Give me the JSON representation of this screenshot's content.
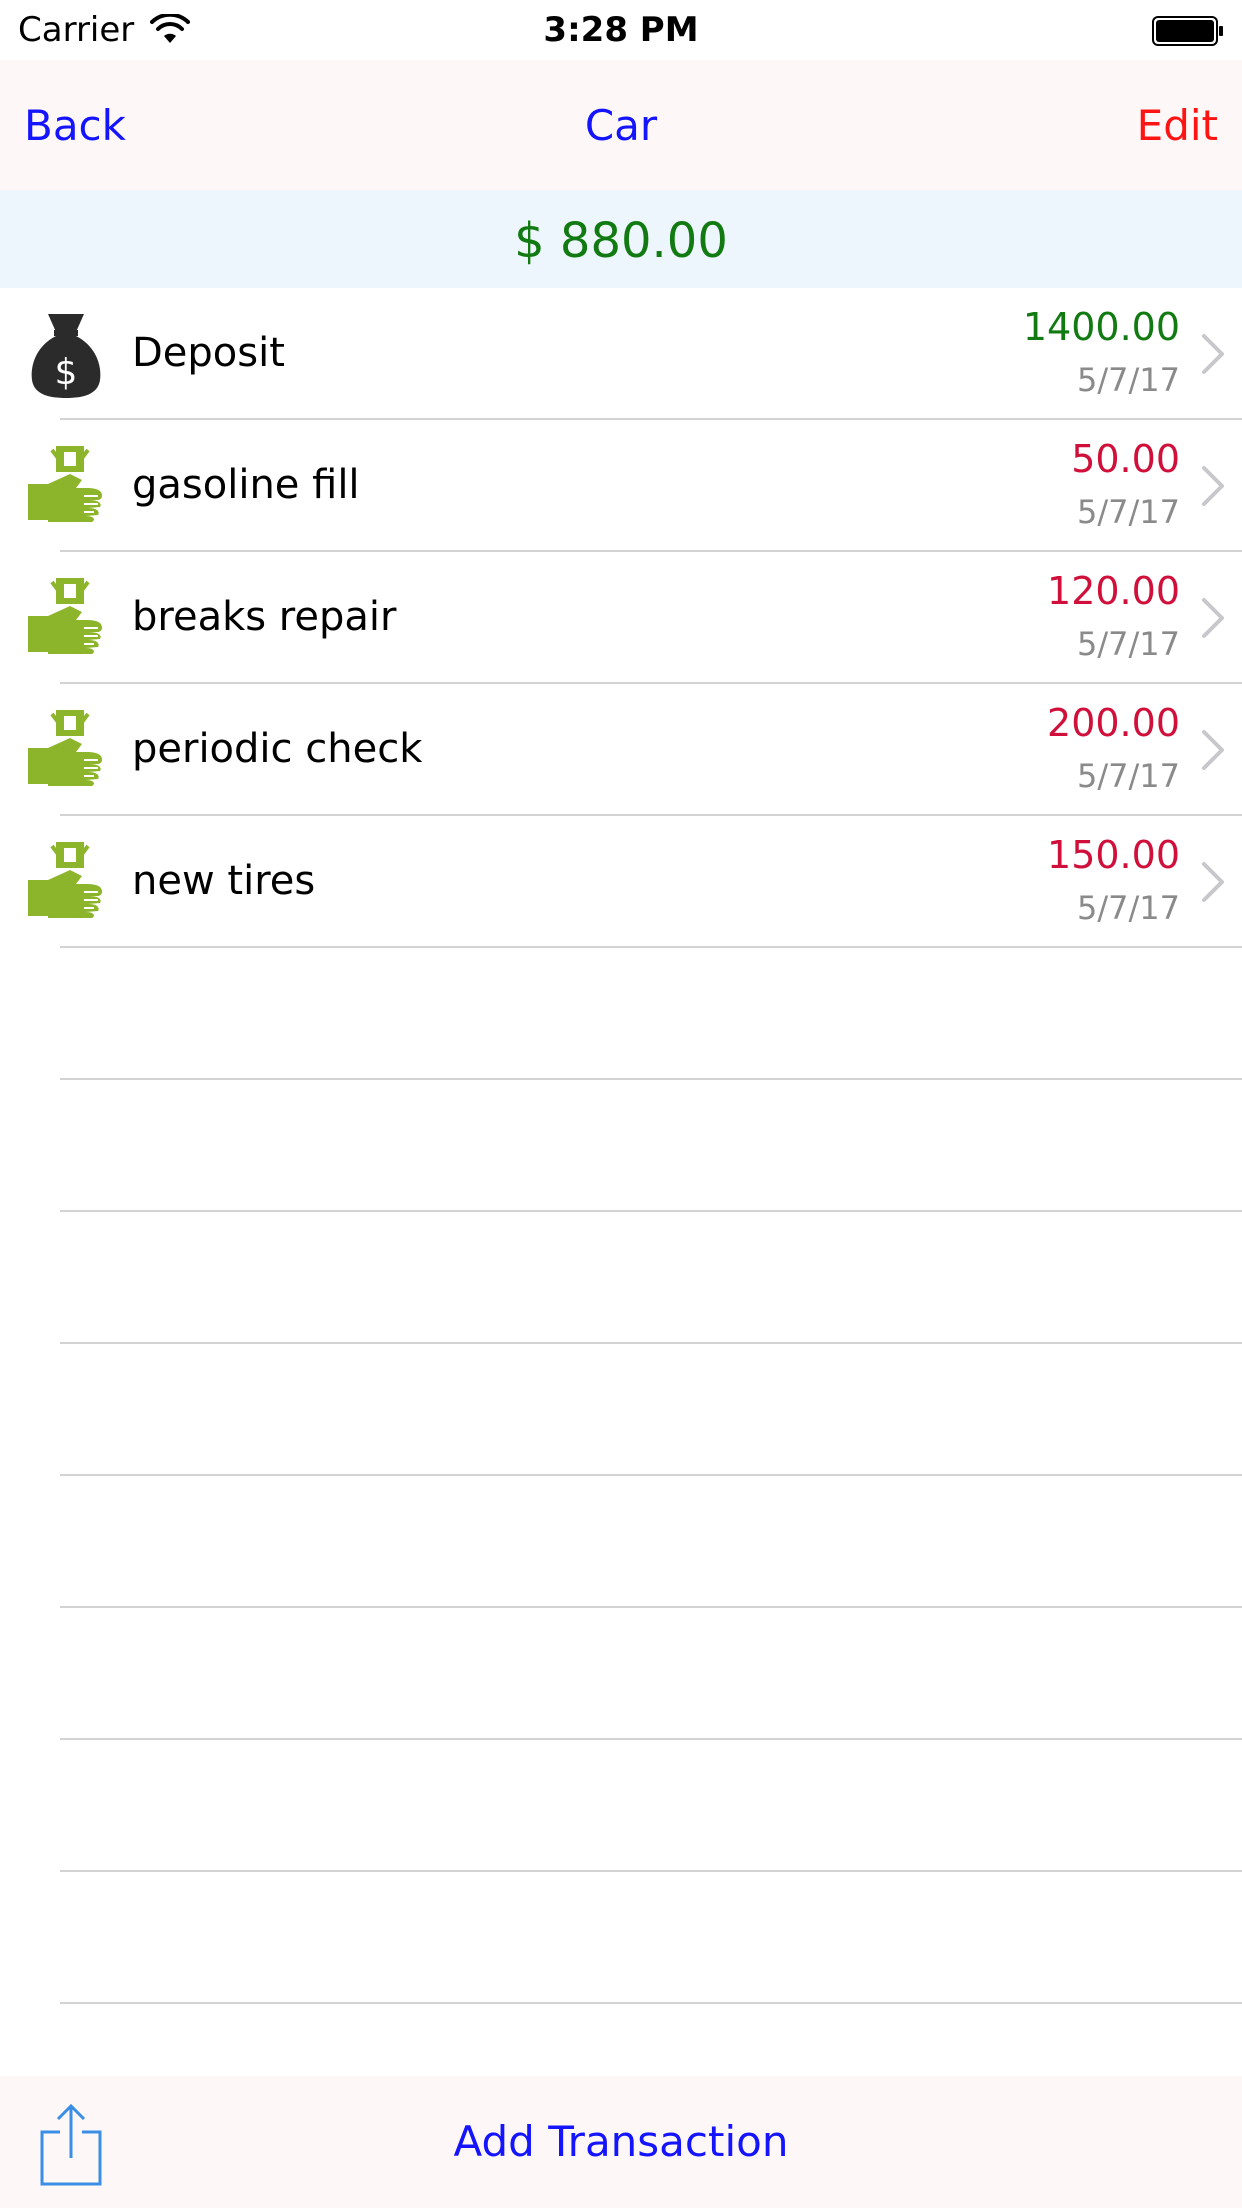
{
  "status_bar": {
    "carrier": "Carrier",
    "time": "3:28 PM",
    "wifi_icon": "wifi-icon",
    "battery_icon": "battery-icon"
  },
  "nav": {
    "back_label": "Back",
    "title": "Car",
    "edit_label": "Edit"
  },
  "balance": {
    "text": "$ 880.00",
    "color": "#117a11"
  },
  "transactions": [
    {
      "label": "Deposit",
      "amount": "1400.00",
      "date": "5/7/17",
      "type": "deposit",
      "icon": "money-bag-icon",
      "amount_color": "#117a11"
    },
    {
      "label": "gasoline fill",
      "amount": "50.00",
      "date": "5/7/17",
      "type": "expense",
      "icon": "hand-money-icon",
      "amount_color": "#d0103a"
    },
    {
      "label": "breaks repair",
      "amount": "120.00",
      "date": "5/7/17",
      "type": "expense",
      "icon": "hand-money-icon",
      "amount_color": "#d0103a"
    },
    {
      "label": "periodic check",
      "amount": "200.00",
      "date": "5/7/17",
      "type": "expense",
      "icon": "hand-money-icon",
      "amount_color": "#d0103a"
    },
    {
      "label": "new tires",
      "amount": "150.00",
      "date": "5/7/17",
      "type": "expense",
      "icon": "hand-money-icon",
      "amount_color": "#d0103a"
    }
  ],
  "toolbar": {
    "share_icon": "share-icon",
    "add_label": "Add Transaction"
  },
  "colors": {
    "nav_bar": "#fdf8f7",
    "balance_bar": "#eef6fd",
    "link_blue": "#1414ff",
    "edit_red": "#ff1414",
    "expense_icon_green": "#8db52c"
  }
}
